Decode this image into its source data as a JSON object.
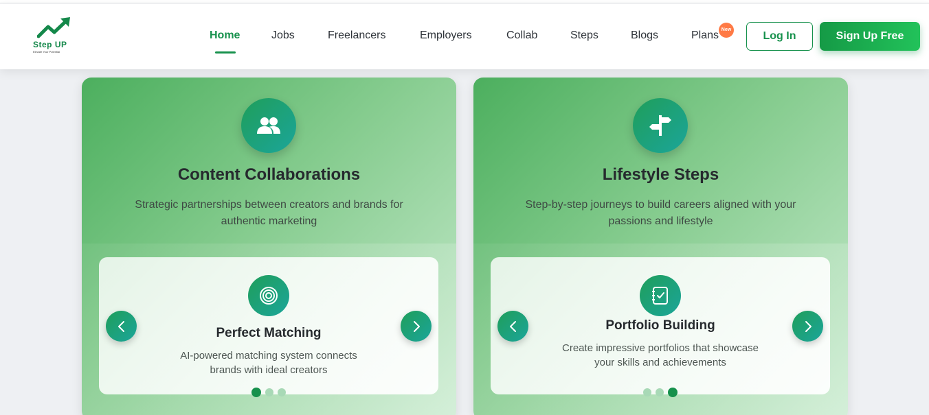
{
  "brand": {
    "name": "Step UP",
    "tagline": "Elevate Your Potential"
  },
  "nav": {
    "items": [
      {
        "label": "Home",
        "active": true
      },
      {
        "label": "Jobs"
      },
      {
        "label": "Freelancers"
      },
      {
        "label": "Employers"
      },
      {
        "label": "Collab"
      },
      {
        "label": "Steps"
      },
      {
        "label": "Blogs"
      },
      {
        "label": "Plans",
        "badge": "New"
      }
    ],
    "login": "Log In",
    "signup": "Sign Up Free"
  },
  "cards": [
    {
      "icon": "users-icon",
      "title": "Content Collaborations",
      "description": "Strategic partnerships between creators and brands for authentic marketing",
      "slide": {
        "icon": "target-icon",
        "title": "Perfect Matching",
        "description": "AI-powered matching system connects brands with ideal creators",
        "active_index": 0,
        "total": 3
      }
    },
    {
      "icon": "signpost-icon",
      "title": "Lifestyle Steps",
      "description": "Step-by-step journeys to build careers aligned with your passions and lifestyle",
      "slide": {
        "icon": "checklist-icon",
        "title": "Portfolio Building",
        "description": "Create impressive portfolios that showcase your skills and achievements",
        "active_index": 2,
        "total": 3
      }
    }
  ],
  "colors": {
    "primary": "#16914c",
    "accent": "#1ba59a",
    "badge": "#ff7a45"
  }
}
